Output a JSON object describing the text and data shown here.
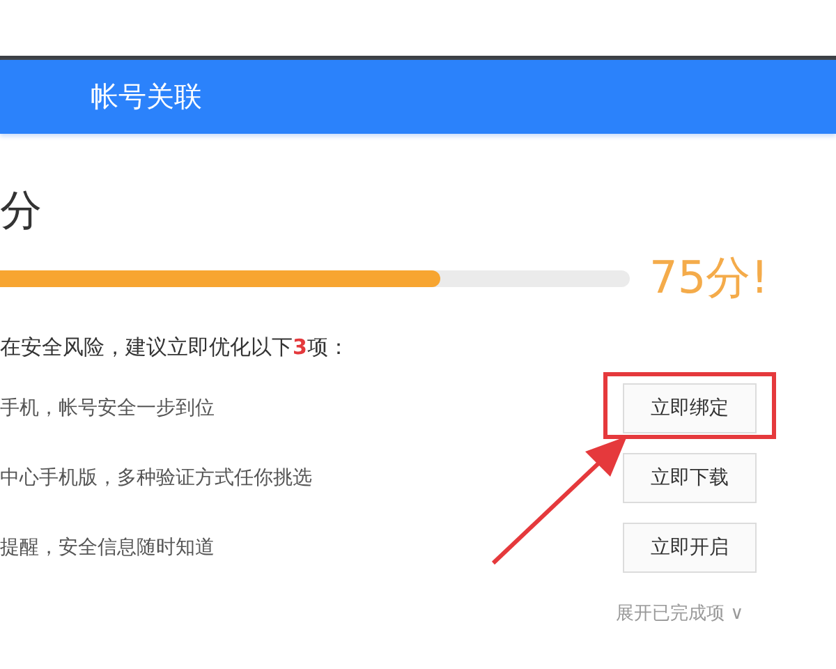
{
  "header": {
    "title": "帐号关联"
  },
  "score": {
    "heading": "分",
    "level": 0.7,
    "value": "75分!"
  },
  "summary": "在安全风险，建议立即优化以下**3**项：",
  "items": [
    {
      "text": "手机，帐号安全一步到位",
      "button": "立即绑定",
      "highlighted": true
    },
    {
      "text": "中心手机版，多种验证方式任你挑选",
      "button": "立即下载",
      "highlighted": false
    },
    {
      "text": "提醒，安全信息随时知道",
      "button": "立即开启",
      "highlighted": false
    }
  ],
  "expand_link": "展开已完成项 ∨"
}
